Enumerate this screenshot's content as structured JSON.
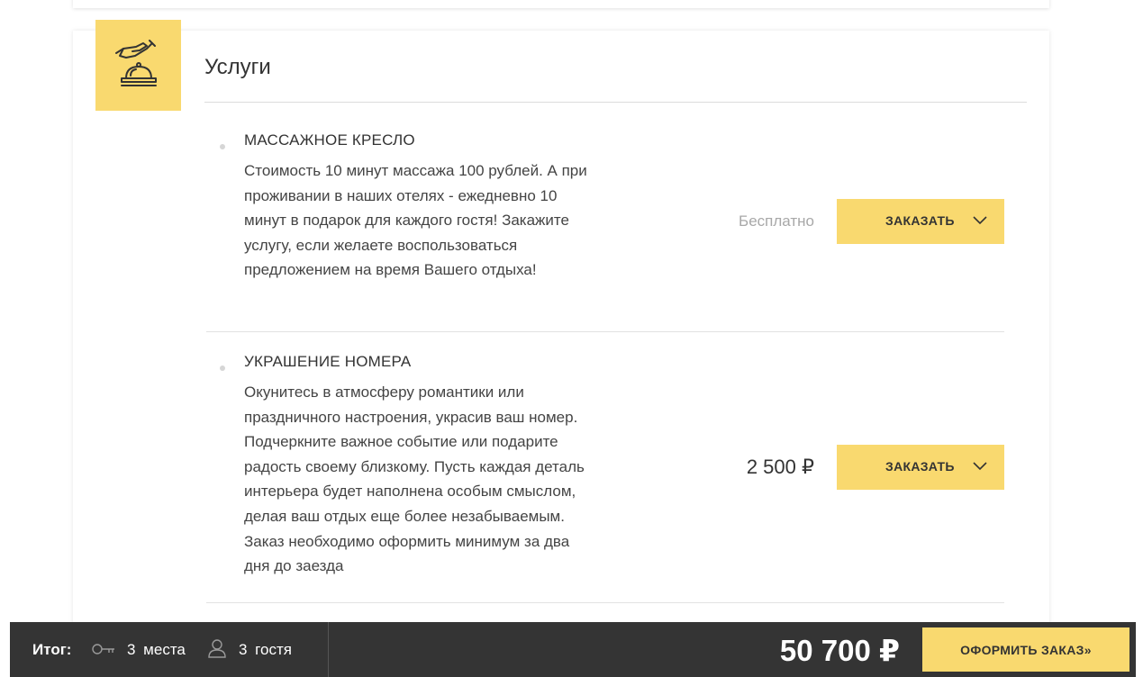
{
  "section": {
    "title": "Услуги",
    "icon": "reception-bell-icon"
  },
  "services": [
    {
      "name": "МАССАЖНОЕ КРЕСЛО",
      "description": "Стоимость 10 минут массажа 100 рублей. А при проживании в наших отелях - ежедневно 10 минут в подарок для каждого гостя! Закажите услугу, если желаете воспользоваться предложением на время Вашего отдыха!",
      "price": "Бесплатно",
      "order_label": "ЗАКАЗАТЬ"
    },
    {
      "name": "УКРАШЕНИЕ НОМЕРА",
      "description": "Окунитесь в атмосферу романтики или праздничного настроения, украсив ваш номер. Подчеркните важное событие или подарите радость своему близкому. Пусть каждая деталь интерьера будет наполнена особым смыслом, делая ваш отдых еще более незабываемым. Заказ необходимо оформить минимум за два дня до заезда",
      "price": "2 500 ₽",
      "order_label": "ЗАКАЗАТЬ"
    }
  ],
  "summary": {
    "total_label": "Итог:",
    "places": "3 места",
    "guests": "3 гостя",
    "total_sum": "50 700 ₽",
    "checkout_label": "ОФОРМИТЬ ЗАКАЗ»"
  },
  "colors": {
    "accent": "#f9d96f",
    "bar": "#343434"
  }
}
